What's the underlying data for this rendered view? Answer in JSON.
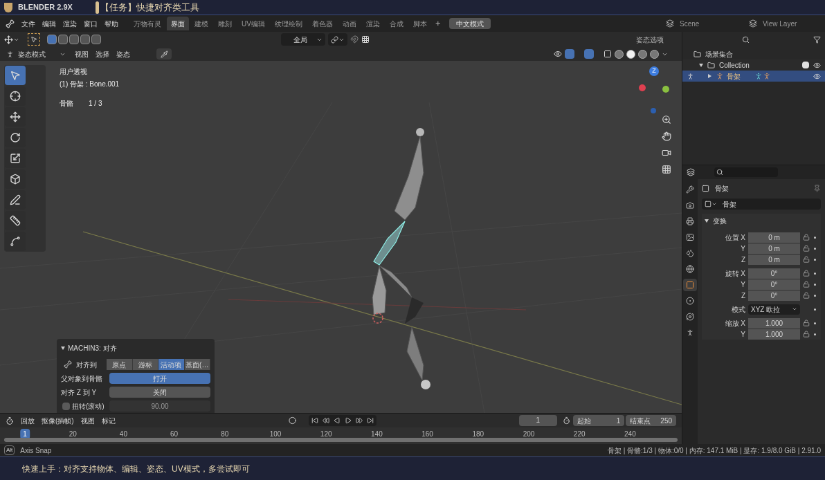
{
  "title_bar": {
    "brand": "BLENDER 2.9X",
    "title": "【任务】快捷对齐类工具"
  },
  "menu_bar": {
    "menus": [
      "文件",
      "编辑",
      "渲染",
      "窗口",
      "帮助"
    ],
    "workspaces": [
      {
        "label": "万物有灵",
        "selected": false
      },
      {
        "label": "界面",
        "selected": true
      },
      {
        "label": "建模",
        "selected": false
      },
      {
        "label": "雕刻",
        "selected": false
      },
      {
        "label": "UV编辑",
        "selected": false
      },
      {
        "label": "纹理绘制",
        "selected": false
      },
      {
        "label": "着色器",
        "selected": false
      },
      {
        "label": "动画",
        "selected": false
      },
      {
        "label": "渲染",
        "selected": false
      },
      {
        "label": "合成",
        "selected": false
      },
      {
        "label": "脚本",
        "selected": false
      }
    ],
    "add": "+",
    "mode_button": "中文模式",
    "scene": "Scene",
    "view_layer": "View Layer"
  },
  "viewport_header": {
    "select_modes": [
      {
        "selected": true
      },
      {
        "selected": false
      },
      {
        "selected": false
      },
      {
        "selected": false
      },
      {
        "selected": false
      }
    ],
    "orientation": "全局"
  },
  "mode_bar": {
    "mode": "姿态模式",
    "menus": [
      "视图",
      "选择",
      "姿态"
    ],
    "options": "姿态选项",
    "shading": [
      {
        "selected": false
      },
      {
        "selected": true
      },
      {
        "selected": false
      },
      {
        "selected": false
      }
    ]
  },
  "viewport": {
    "view": "用户透视",
    "object": "(1) 骨架 : Bone.001",
    "stat_label": "骨骼",
    "stat_value": "1 / 3",
    "gizmo_axis": "Z",
    "tools": [
      {
        "selected": true
      },
      {
        "selected": false
      },
      {
        "selected": false
      },
      {
        "selected": false
      },
      {
        "selected": false
      },
      {
        "selected": false
      },
      {
        "selected": false
      },
      {
        "selected": false
      },
      {
        "selected": false
      }
    ]
  },
  "operator": {
    "title": "MACHIN3: 对齐",
    "align_label": "对齐到",
    "align_options": [
      {
        "label": "原点",
        "selected": false
      },
      {
        "label": "游标",
        "selected": false
      },
      {
        "label": "活动项",
        "selected": true
      },
      {
        "label": "基面(…",
        "selected": false
      }
    ],
    "rows": [
      {
        "label": "父对象到骨骼",
        "value": "打开",
        "on": true
      },
      {
        "label": "对齐 Z 到 Y",
        "value": "关闭",
        "on": false
      }
    ],
    "roll": {
      "label": "扭转(滚动)",
      "checked": false,
      "value": "90.00",
      "disabled": true
    }
  },
  "outliner": {
    "items": [
      {
        "label": "场景集合",
        "children": [
          {
            "label": "Collection",
            "checked": true,
            "children": [
              {
                "label": "骨架",
                "selected": true
              }
            ]
          }
        ]
      }
    ]
  },
  "properties": {
    "tabs": [
      {
        "selected": false
      },
      {
        "selected": false
      },
      {
        "selected": false
      },
      {
        "selected": false
      },
      {
        "selected": false
      },
      {
        "selected": false
      },
      {
        "selected": true
      },
      {
        "selected": false
      },
      {
        "selected": false
      },
      {
        "selected": false
      }
    ],
    "object": "骨架",
    "data": "骨架",
    "panel": "变换",
    "expanded": true,
    "rows": [
      {
        "kind": "field",
        "label": "位置",
        "axis": "X",
        "value": "0 m"
      },
      {
        "kind": "field",
        "axis": "Y",
        "value": "0 m"
      },
      {
        "kind": "field",
        "axis": "Z",
        "value": "0 m"
      },
      {
        "kind": "field",
        "label": "旋转",
        "axis": "X",
        "value": "0°"
      },
      {
        "kind": "field",
        "axis": "Y",
        "value": "0°"
      },
      {
        "kind": "field",
        "axis": "Z",
        "value": "0°"
      },
      {
        "kind": "dropdown",
        "label": "模式",
        "value": "XYZ 欧拉"
      },
      {
        "kind": "field",
        "label": "缩放",
        "axis": "X",
        "value": "1.000"
      },
      {
        "kind": "field",
        "axis": "Y",
        "value": "1.000"
      }
    ]
  },
  "timeline": {
    "menus": [
      "回放",
      "抠像(插帧)",
      "视图",
      "标记"
    ],
    "current_frame": "1",
    "start_label": "起始",
    "start": "1",
    "end_label": "结束点",
    "end": "250",
    "ruler": [
      {
        "label": "1",
        "selected": true
      },
      {
        "label": "20",
        "selected": false
      },
      {
        "label": "40",
        "selected": false
      },
      {
        "label": "60",
        "selected": false
      },
      {
        "label": "80",
        "selected": false
      },
      {
        "label": "100",
        "selected": false
      },
      {
        "label": "120",
        "selected": false
      },
      {
        "label": "140",
        "selected": false
      },
      {
        "label": "160",
        "selected": false
      },
      {
        "label": "180",
        "selected": false
      },
      {
        "label": "200",
        "selected": false
      },
      {
        "label": "220",
        "selected": false
      },
      {
        "label": "240",
        "selected": false
      }
    ]
  },
  "status_bar": {
    "key": "Alt",
    "hint": "Axis Snap",
    "info": "骨架 | 骨骼:1/3 | 物体:0/0 | 内存: 147.1 MiB | 显存: 1.9/8.0 GiB | 2.91.0"
  },
  "caption": {
    "text": "快速上手：对齐支持物体、编辑、姿态、UV模式，多尝试即可"
  }
}
